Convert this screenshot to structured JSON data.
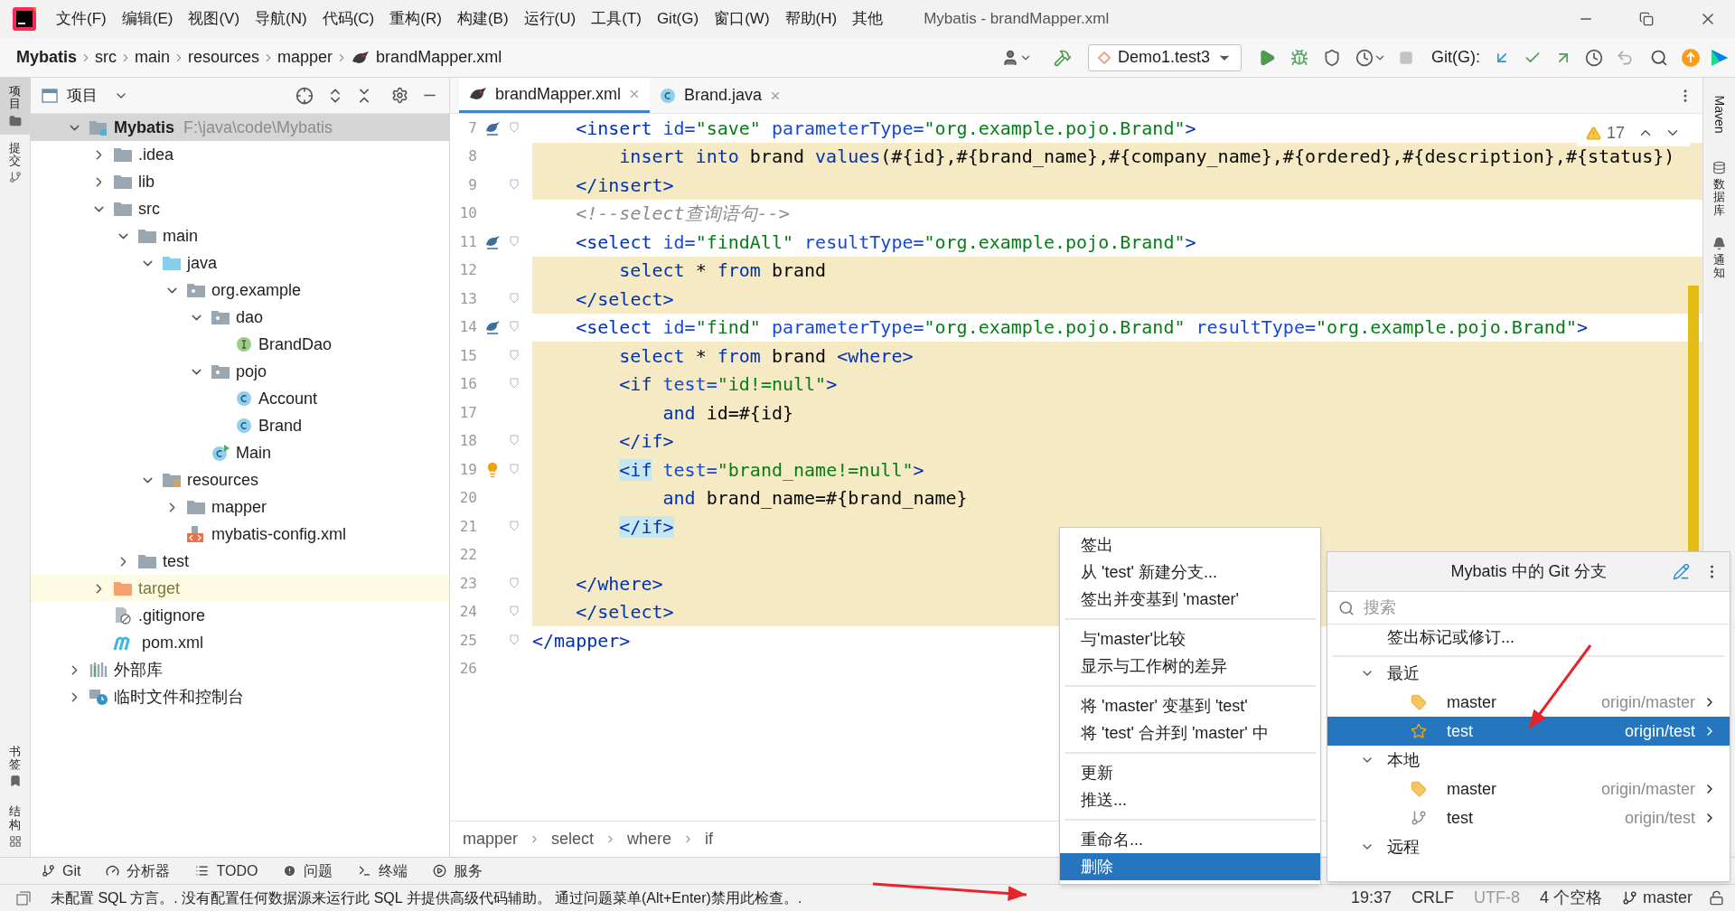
{
  "menu": {
    "items": [
      "文件(F)",
      "编辑(E)",
      "视图(V)",
      "导航(N)",
      "代码(C)",
      "重构(R)",
      "构建(B)",
      "运行(U)",
      "工具(T)",
      "Git(G)",
      "窗口(W)",
      "帮助(H)",
      "其他"
    ],
    "title": "Mybatis - brandMapper.xml"
  },
  "navbar": {
    "crumbs": [
      "Mybatis",
      "src",
      "main",
      "resources",
      "mapper",
      "brandMapper.xml"
    ],
    "run_config": "Demo1.test3",
    "git_label": "Git(G):"
  },
  "left_strip": {
    "top": [
      {
        "label": "项目",
        "selected": true
      },
      {
        "label": "提交",
        "selected": false
      }
    ],
    "bottom": [
      {
        "label": "书签",
        "selected": false
      },
      {
        "label": "结构",
        "selected": false
      }
    ]
  },
  "project": {
    "title": "项目",
    "tree": [
      {
        "label": "Mybatis",
        "path": "F:\\java\\code\\Mybatis",
        "kind": "project",
        "expanded": true,
        "selected": true,
        "children": [
          {
            "label": ".idea",
            "kind": "folder",
            "expanded": false,
            "selected": false
          },
          {
            "label": "lib",
            "kind": "folder",
            "expanded": false,
            "selected": false
          },
          {
            "label": "src",
            "kind": "folder",
            "expanded": true,
            "selected": false,
            "children": [
              {
                "label": "main",
                "kind": "folder",
                "expanded": true,
                "selected": false,
                "children": [
                  {
                    "label": "java",
                    "kind": "source",
                    "expanded": true,
                    "selected": false,
                    "children": [
                      {
                        "label": "org.example",
                        "kind": "package",
                        "expanded": true,
                        "selected": false,
                        "children": [
                          {
                            "label": "dao",
                            "kind": "package",
                            "expanded": true,
                            "selected": false,
                            "children": [
                              {
                                "label": "BrandDao",
                                "kind": "interface",
                                "selected": false
                              }
                            ]
                          },
                          {
                            "label": "pojo",
                            "kind": "package",
                            "expanded": true,
                            "selected": false,
                            "children": [
                              {
                                "label": "Account",
                                "kind": "class",
                                "selected": false
                              },
                              {
                                "label": "Brand",
                                "kind": "class",
                                "selected": false
                              }
                            ]
                          },
                          {
                            "label": "Main",
                            "kind": "main",
                            "selected": false
                          }
                        ]
                      }
                    ]
                  },
                  {
                    "label": "resources",
                    "kind": "resources",
                    "expanded": true,
                    "selected": false,
                    "children": [
                      {
                        "label": "mapper",
                        "kind": "folder",
                        "expanded": false,
                        "selected": false
                      },
                      {
                        "label": "mybatis-config.xml",
                        "kind": "xml",
                        "selected": false
                      }
                    ]
                  }
                ]
              },
              {
                "label": "test",
                "kind": "folder",
                "expanded": false,
                "selected": false
              }
            ]
          },
          {
            "label": "target",
            "kind": "excluded",
            "expanded": false,
            "selected": false
          },
          {
            "label": ".gitignore",
            "kind": "gitignore",
            "selected": false
          },
          {
            "label": "pom.xml",
            "kind": "maven",
            "selected": false
          }
        ]
      },
      {
        "label": "外部库",
        "kind": "library",
        "expanded": false,
        "selected": false
      },
      {
        "label": "临时文件和控制台",
        "kind": "scratch",
        "expanded": false,
        "selected": false
      }
    ]
  },
  "editor": {
    "tabs": [
      {
        "label": "brandMapper.xml",
        "kind": "mapper",
        "selected": true
      },
      {
        "label": "Brand.java",
        "kind": "class",
        "selected": false
      }
    ],
    "warnings": "17",
    "lines": [
      {
        "number": "7",
        "kind": "mapper",
        "fold": true,
        "highlighted": false,
        "tokens": [
          {
            "kind": "tag",
            "text": "    <insert "
          },
          {
            "kind": "attr",
            "text": "id="
          },
          {
            "kind": "string",
            "text": "\"save\" "
          },
          {
            "kind": "attr",
            "text": "parameterType="
          },
          {
            "kind": "string",
            "text": "\"org.example.pojo.Brand\""
          },
          {
            "kind": "tag",
            "text": ">"
          }
        ]
      },
      {
        "number": "8",
        "fold": false,
        "highlighted": true,
        "tokens": [
          {
            "kind": "keyword",
            "text": "        insert into "
          },
          {
            "kind": "text",
            "text": "brand "
          },
          {
            "kind": "keyword",
            "text": "values"
          },
          {
            "kind": "text",
            "text": "(#{id},#{brand_name},#{company_name},#{ordered},#{description},#{status})"
          }
        ]
      },
      {
        "number": "9",
        "fold": true,
        "highlighted": true,
        "tokens": [
          {
            "kind": "tag",
            "text": "    </insert>"
          }
        ]
      },
      {
        "number": "10",
        "fold": false,
        "highlighted": false,
        "tokens": [
          {
            "kind": "comment",
            "text": "    <!--select查询语句-->"
          }
        ]
      },
      {
        "number": "11",
        "kind": "mapper",
        "fold": true,
        "highlighted": false,
        "tokens": [
          {
            "kind": "tag",
            "text": "    <select "
          },
          {
            "kind": "attr",
            "text": "id="
          },
          {
            "kind": "string",
            "text": "\"findAll\" "
          },
          {
            "kind": "attr",
            "text": "resultType="
          },
          {
            "kind": "string",
            "text": "\"org.example.pojo.Brand\""
          },
          {
            "kind": "tag",
            "text": ">"
          }
        ]
      },
      {
        "number": "12",
        "fold": false,
        "highlighted": true,
        "tokens": [
          {
            "kind": "keyword",
            "text": "        select "
          },
          {
            "kind": "text",
            "text": "* "
          },
          {
            "kind": "keyword",
            "text": "from "
          },
          {
            "kind": "text",
            "text": "brand"
          }
        ]
      },
      {
        "number": "13",
        "fold": true,
        "highlighted": true,
        "tokens": [
          {
            "kind": "tag",
            "text": "    </select>"
          }
        ]
      },
      {
        "number": "14",
        "kind": "mapper",
        "fold": true,
        "highlighted": false,
        "tokens": [
          {
            "kind": "tag",
            "text": "    <select "
          },
          {
            "kind": "attr",
            "text": "id="
          },
          {
            "kind": "string",
            "text": "\"find\" "
          },
          {
            "kind": "attr",
            "text": "parameterType="
          },
          {
            "kind": "string",
            "text": "\"org.example.pojo.Brand\" "
          },
          {
            "kind": "attr",
            "text": "resultType="
          },
          {
            "kind": "string",
            "text": "\"org.example.pojo.Brand\""
          },
          {
            "kind": "tag",
            "text": ">"
          }
        ]
      },
      {
        "number": "15",
        "fold": true,
        "highlighted": true,
        "tokens": [
          {
            "kind": "keyword",
            "text": "        select "
          },
          {
            "kind": "text",
            "text": "* "
          },
          {
            "kind": "keyword",
            "text": "from "
          },
          {
            "kind": "text",
            "text": "brand "
          },
          {
            "kind": "tag",
            "text": "<where>"
          }
        ]
      },
      {
        "number": "16",
        "fold": true,
        "highlighted": true,
        "tokens": [
          {
            "kind": "tag",
            "text": "        <if "
          },
          {
            "kind": "attr",
            "text": "test="
          },
          {
            "kind": "string",
            "text": "\"id!=null\""
          },
          {
            "kind": "tag",
            "text": ">"
          }
        ]
      },
      {
        "number": "17",
        "fold": false,
        "highlighted": true,
        "tokens": [
          {
            "kind": "keyword",
            "text": "            and "
          },
          {
            "kind": "text",
            "text": "id=#{id}"
          }
        ]
      },
      {
        "number": "18",
        "fold": true,
        "highlighted": true,
        "tokens": [
          {
            "kind": "tag",
            "text": "        </if>"
          }
        ]
      },
      {
        "number": "19",
        "kind": "bulb",
        "fold": true,
        "highlighted": true,
        "tokens": [
          {
            "kind": "match",
            "text": "        <if"
          },
          {
            "kind": "attr",
            "text": " test="
          },
          {
            "kind": "string",
            "text": "\"brand_name!=null\""
          },
          {
            "kind": "tag",
            "text": ">"
          }
        ]
      },
      {
        "number": "20",
        "fold": false,
        "highlighted": true,
        "tokens": [
          {
            "kind": "keyword",
            "text": "            and "
          },
          {
            "kind": "text",
            "text": "brand_name=#{brand_name}"
          }
        ]
      },
      {
        "number": "21",
        "fold": true,
        "highlighted": true,
        "tokens": [
          {
            "kind": "match",
            "text": "        </if>"
          }
        ]
      },
      {
        "number": "22",
        "fold": false,
        "highlighted": true
      },
      {
        "number": "23",
        "fold": true,
        "highlighted": true,
        "tokens": [
          {
            "kind": "tag",
            "text": "    </where>"
          }
        ]
      },
      {
        "number": "24",
        "fold": true,
        "highlighted": true,
        "tokens": [
          {
            "kind": "tag",
            "text": "    </select>"
          }
        ]
      },
      {
        "number": "25",
        "fold": true,
        "highlighted": false,
        "tokens": [
          {
            "kind": "tag",
            "text": "</mapper>"
          }
        ]
      },
      {
        "number": "26",
        "fold": false,
        "highlighted": false
      }
    ],
    "breadcrumbs": [
      "mapper",
      "select",
      "where",
      "if"
    ]
  },
  "right_strip": [
    {
      "label": "Maven",
      "kind": "latin"
    },
    {
      "label": "数据库",
      "kind": "cjk"
    },
    {
      "label": "通知",
      "kind": "cjk"
    }
  ],
  "context_menu": {
    "groups": [
      [
        {
          "label": "签出",
          "selected": false
        },
        {
          "label": "从 'test' 新建分支...",
          "selected": false
        },
        {
          "label": "签出并变基到 'master'",
          "selected": false
        }
      ],
      [
        {
          "label": "与'master'比较",
          "selected": false
        },
        {
          "label": "显示与工作树的差异",
          "selected": false
        }
      ],
      [
        {
          "label": "将 'master' 变基到 'test'",
          "selected": false
        },
        {
          "label": "将 'test' 合并到 'master' 中",
          "selected": false
        }
      ],
      [
        {
          "label": "更新",
          "selected": false
        },
        {
          "label": "推送...",
          "selected": false
        }
      ],
      [
        {
          "label": "重命名...",
          "selected": false
        },
        {
          "label": "删除",
          "selected": true
        }
      ]
    ]
  },
  "git_popup": {
    "title": "Mybatis 中的 Git 分支",
    "search": {
      "placeholder": "搜索"
    },
    "checkout_tag": "签出标记或修订...",
    "sections": [
      {
        "label": "最近",
        "expanded": true,
        "branches": [
          {
            "name": "master",
            "remote": "origin/master",
            "kind": "tag",
            "selected": false
          },
          {
            "name": "test",
            "remote": "origin/test",
            "kind": "star",
            "selected": true
          }
        ]
      },
      {
        "label": "本地",
        "expanded": true,
        "branches": [
          {
            "name": "master",
            "remote": "origin/master",
            "kind": "tag",
            "selected": false
          },
          {
            "name": "test",
            "remote": "origin/test",
            "kind": "branch",
            "selected": false
          }
        ]
      },
      {
        "label": "远程",
        "expanded": true
      }
    ]
  },
  "tool_tabs": [
    {
      "label": "Git",
      "kind": "branch"
    },
    {
      "label": "分析器",
      "kind": "profiler"
    },
    {
      "label": "TODO",
      "kind": "list"
    },
    {
      "label": "问题",
      "kind": "problem"
    },
    {
      "label": "终端",
      "kind": "terminal"
    },
    {
      "label": "服务",
      "kind": "service"
    }
  ],
  "status_bar": {
    "message": "未配置 SQL 方言。. 没有配置任何数据源来运行此 SQL 并提供高级代码辅助。 通过问题菜单(Alt+Enter)禁用此检查。.",
    "items": [
      {
        "text": "19:37",
        "disabled": false,
        "kind": "text"
      },
      {
        "text": "CRLF",
        "disabled": false,
        "kind": "text"
      },
      {
        "text": "UTF-8",
        "disabled": true,
        "kind": "text"
      },
      {
        "text": "4 个空格",
        "disabled": false,
        "kind": "text"
      },
      {
        "text": "master",
        "disabled": false,
        "kind": "branch"
      }
    ]
  }
}
